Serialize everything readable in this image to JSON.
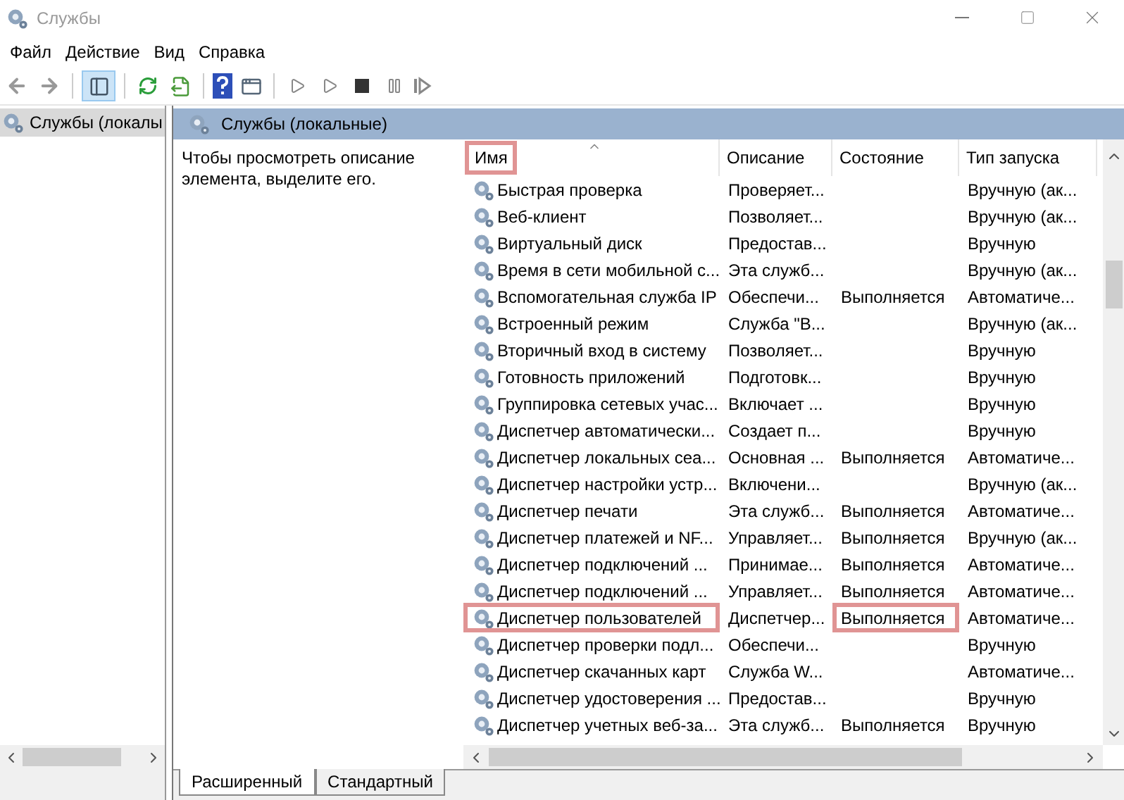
{
  "window": {
    "title": "Службы"
  },
  "menu": [
    "Файл",
    "Действие",
    "Вид",
    "Справка"
  ],
  "toolbar": {
    "tree_toggle_pressed": true
  },
  "tree": {
    "items": [
      {
        "label": "Службы (локалы",
        "selected": true
      }
    ]
  },
  "panel": {
    "title": "Службы (локальные)",
    "hint": "Чтобы просмотреть описание элемента, выделите его."
  },
  "table": {
    "columns": [
      {
        "label": "Имя",
        "sorted": true,
        "marked": true
      },
      {
        "label": "Описание",
        "sorted": false,
        "marked": false
      },
      {
        "label": "Состояние",
        "sorted": false,
        "marked": false
      },
      {
        "label": "Тип запуска",
        "sorted": false,
        "marked": false
      }
    ],
    "rows": [
      {
        "name": "Быстрая проверка",
        "description": "Проверяет...",
        "startup": "Вручную (ак...",
        "name_marked": false,
        "status_marked": false
      },
      {
        "name": "Веб-клиент",
        "description": "Позволяет...",
        "startup": "Вручную (ак...",
        "name_marked": false,
        "status_marked": false
      },
      {
        "name": "Виртуальный диск",
        "description": "Предостав...",
        "startup": "Вручную",
        "name_marked": false,
        "status_marked": false
      },
      {
        "name": "Время в сети мобильной с...",
        "description": "Эта служб...",
        "startup": "Вручную (ак...",
        "name_marked": false,
        "status_marked": false
      },
      {
        "name": "Вспомогательная служба IP",
        "description": "Обеспечи...",
        "status": "Выполняется",
        "startup": "Автоматиче...",
        "name_marked": false,
        "status_marked": false
      },
      {
        "name": "Встроенный режим",
        "description": "Служба \"В...",
        "startup": "Вручную (ак...",
        "name_marked": false,
        "status_marked": false
      },
      {
        "name": "Вторичный вход в систему",
        "description": "Позволяет...",
        "startup": "Вручную",
        "name_marked": false,
        "status_marked": false
      },
      {
        "name": "Готовность приложений",
        "description": "Подготовк...",
        "startup": "Вручную",
        "name_marked": false,
        "status_marked": false
      },
      {
        "name": "Группировка сетевых учас...",
        "description": "Включает ...",
        "startup": "Вручную",
        "name_marked": false,
        "status_marked": false
      },
      {
        "name": "Диспетчер автоматически...",
        "description": "Создает п...",
        "startup": "Вручную",
        "name_marked": false,
        "status_marked": false
      },
      {
        "name": "Диспетчер локальных сеа...",
        "description": "Основная ...",
        "status": "Выполняется",
        "startup": "Автоматиче...",
        "name_marked": false,
        "status_marked": false
      },
      {
        "name": "Диспетчер настройки устр...",
        "description": "Включени...",
        "startup": "Вручную (ак...",
        "name_marked": false,
        "status_marked": false
      },
      {
        "name": "Диспетчер печати",
        "description": "Эта служб...",
        "status": "Выполняется",
        "startup": "Автоматиче...",
        "name_marked": false,
        "status_marked": false
      },
      {
        "name": "Диспетчер платежей и NF...",
        "description": "Управляет...",
        "status": "Выполняется",
        "startup": "Вручную (ак...",
        "name_marked": false,
        "status_marked": false
      },
      {
        "name": "Диспетчер подключений ...",
        "description": "Принимае...",
        "status": "Выполняется",
        "startup": "Автоматиче...",
        "name_marked": false,
        "status_marked": false
      },
      {
        "name": "Диспетчер подключений ...",
        "description": "Управляет...",
        "status": "Выполняется",
        "startup": "Автоматиче...",
        "name_marked": false,
        "status_marked": false
      },
      {
        "name": "Диспетчер пользователей",
        "description": "Диспетчер...",
        "status": "Выполняется",
        "startup": "Автоматиче...",
        "name_marked": true,
        "status_marked": true
      },
      {
        "name": "Диспетчер проверки подл...",
        "description": "Обеспечи...",
        "startup": "Вручную",
        "name_marked": false,
        "status_marked": false
      },
      {
        "name": "Диспетчер скачанных карт",
        "description": "Служба W...",
        "startup": "Автоматиче...",
        "name_marked": false,
        "status_marked": false
      },
      {
        "name": "Диспетчер удостоверения ...",
        "description": "Предостав...",
        "startup": "Вручную",
        "name_marked": false,
        "status_marked": false
      },
      {
        "name": "Диспетчер учетных веб-за...",
        "description": "Эта служб...",
        "status": "Выполняется",
        "startup": "Вручную",
        "name_marked": false,
        "status_marked": false
      }
    ]
  },
  "tabs": [
    {
      "label": "Расширенный",
      "selected": true
    },
    {
      "label": "Стандартный",
      "selected": false
    }
  ]
}
